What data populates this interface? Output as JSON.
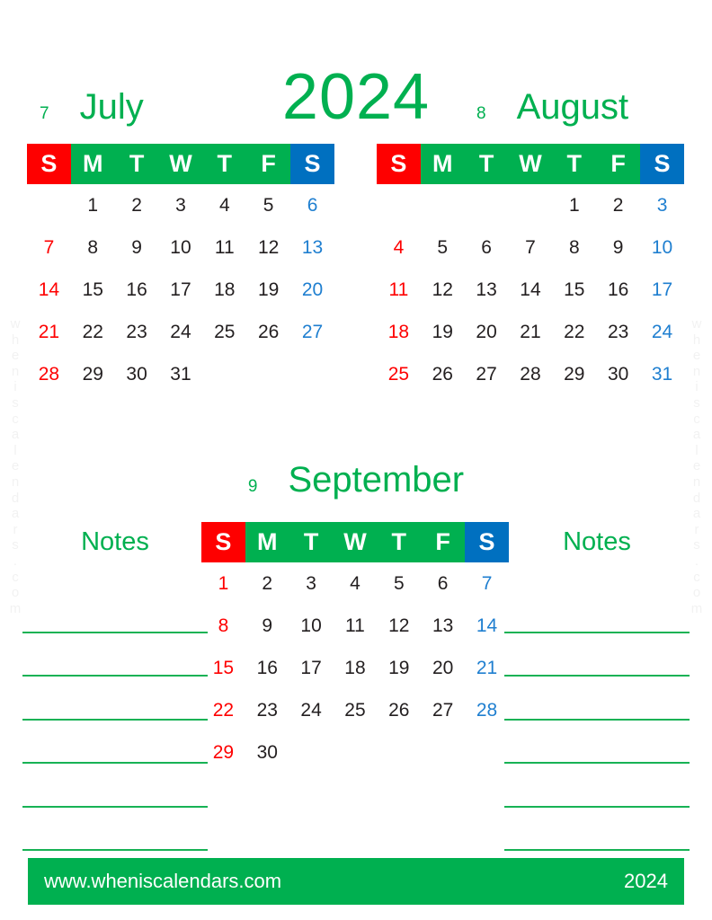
{
  "year": "2024",
  "header": {
    "july": {
      "number": "7",
      "name": "July"
    },
    "august": {
      "number": "8",
      "name": "August"
    },
    "year_big": "2024"
  },
  "september_header": {
    "number": "9",
    "name": "September"
  },
  "weekday_headers": [
    "S",
    "M",
    "T",
    "W",
    "T",
    "F",
    "S"
  ],
  "colors": {
    "sunday": "#fe0000",
    "weekday": "#00b050",
    "saturday": "#0070c0",
    "date_text": "#231f20",
    "sunday_text": "#fe0000",
    "saturday_text": "#1f7fd0",
    "line": "#17b255"
  },
  "months": [
    {
      "id": "july",
      "number": "7",
      "name": "July",
      "first_weekday_index": 1,
      "days_in_month": 31,
      "weeks": [
        [
          "",
          "1",
          "2",
          "3",
          "4",
          "5",
          "6"
        ],
        [
          "7",
          "8",
          "9",
          "10",
          "11",
          "12",
          "13"
        ],
        [
          "14",
          "15",
          "16",
          "17",
          "18",
          "19",
          "20"
        ],
        [
          "21",
          "22",
          "23",
          "24",
          "25",
          "26",
          "27"
        ],
        [
          "28",
          "29",
          "30",
          "31",
          "",
          "",
          ""
        ]
      ]
    },
    {
      "id": "august",
      "number": "8",
      "name": "August",
      "first_weekday_index": 4,
      "days_in_month": 31,
      "weeks": [
        [
          "",
          "",
          "",
          "",
          "1",
          "2",
          "3"
        ],
        [
          "4",
          "5",
          "6",
          "7",
          "8",
          "9",
          "10"
        ],
        [
          "11",
          "12",
          "13",
          "14",
          "15",
          "16",
          "17"
        ],
        [
          "18",
          "19",
          "20",
          "21",
          "22",
          "23",
          "24"
        ],
        [
          "25",
          "26",
          "27",
          "28",
          "29",
          "30",
          "31"
        ]
      ]
    },
    {
      "id": "september",
      "number": "9",
      "name": "September",
      "first_weekday_index": 0,
      "days_in_month": 30,
      "weeks": [
        [
          "1",
          "2",
          "3",
          "4",
          "5",
          "6",
          "7"
        ],
        [
          "8",
          "9",
          "10",
          "11",
          "12",
          "13",
          "14"
        ],
        [
          "15",
          "16",
          "17",
          "18",
          "19",
          "20",
          "21"
        ],
        [
          "22",
          "23",
          "24",
          "25",
          "26",
          "27",
          "28"
        ],
        [
          "29",
          "30",
          "",
          "",
          "",
          "",
          ""
        ]
      ]
    }
  ],
  "notes": {
    "left_title": "Notes",
    "right_title": "Notes",
    "line_count": 6
  },
  "footer": {
    "url": "www.wheniscalendars.com",
    "year": "2024"
  },
  "watermark": {
    "text": "wheniscalendars.com"
  }
}
